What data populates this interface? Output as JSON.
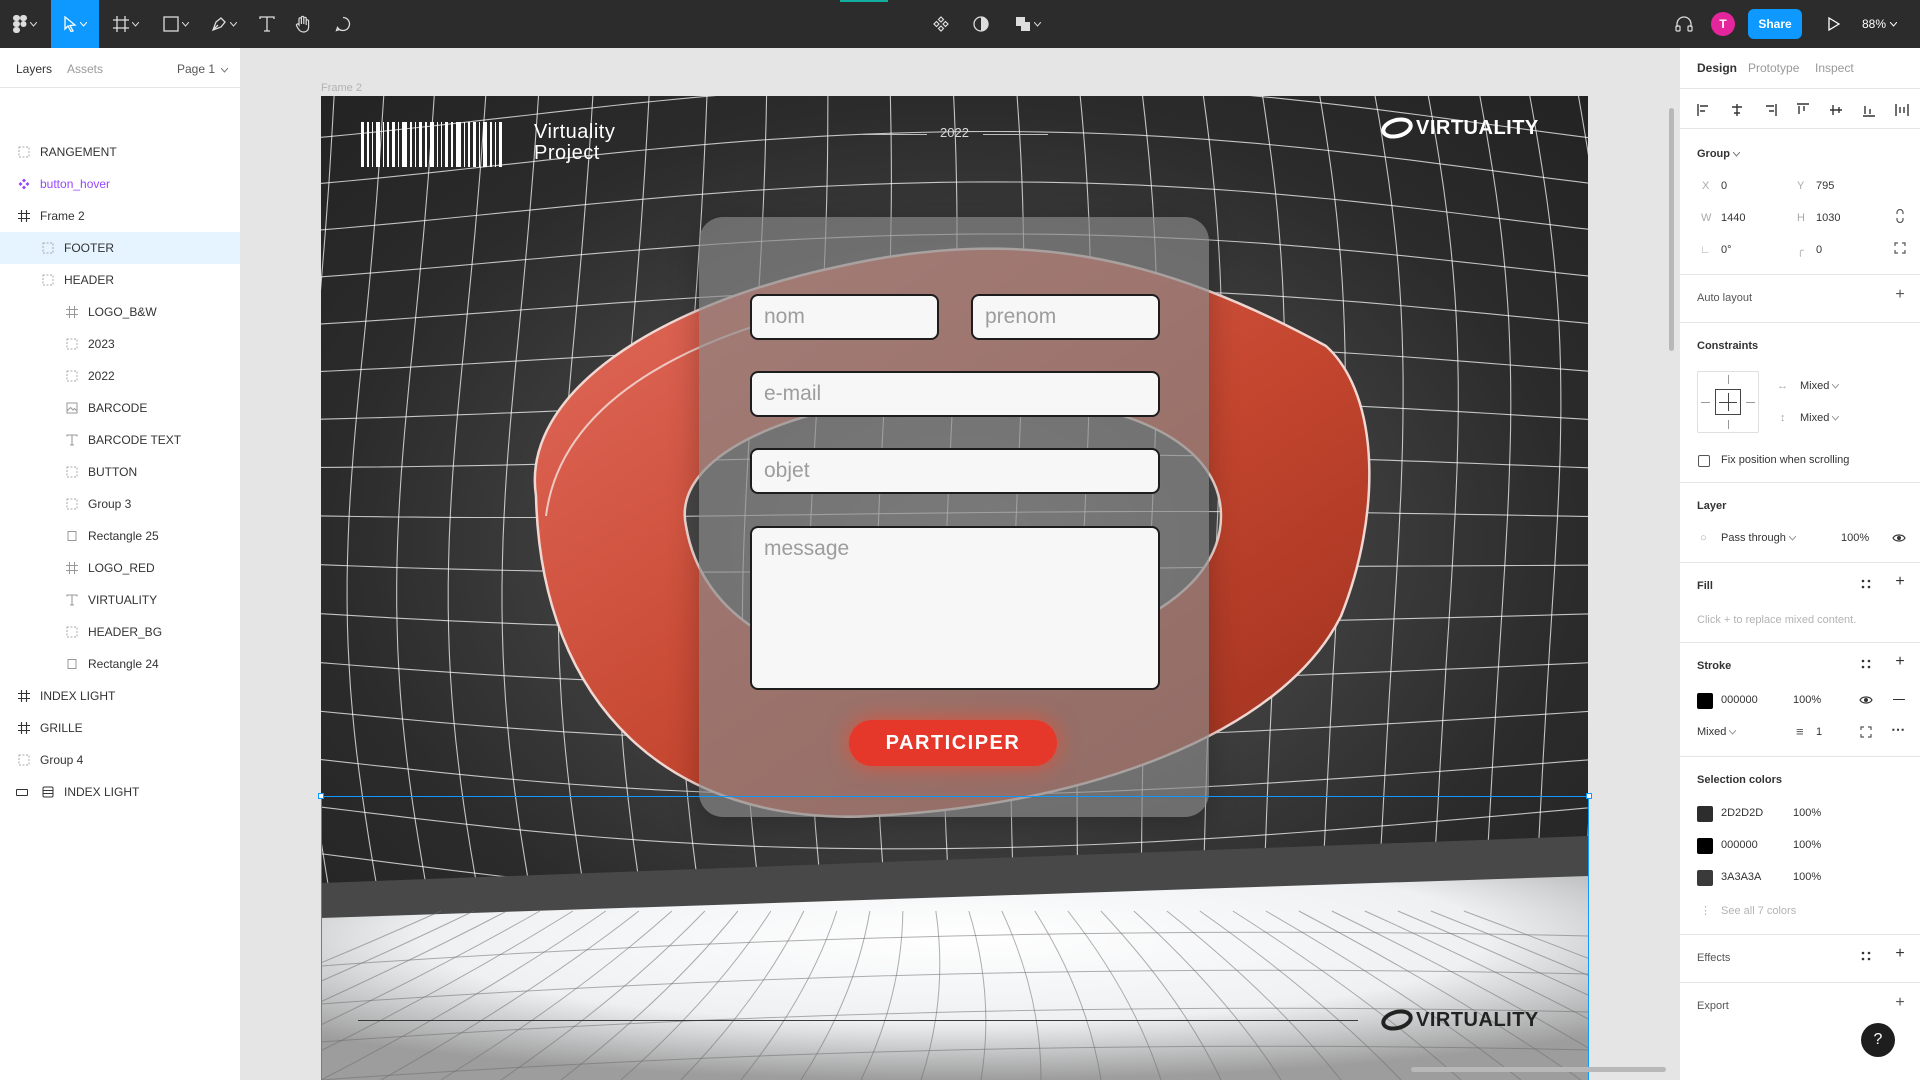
{
  "toolbar": {
    "zoom": "88%",
    "share_label": "Share",
    "avatar_initial": "T",
    "tools": [
      "main-menu-icon",
      "move-tool-icon",
      "frame-tool-icon",
      "rectangle-tool-icon",
      "pen-tool-icon",
      "text-tool-icon",
      "hand-tool-icon",
      "comment-tool-icon"
    ]
  },
  "left": {
    "tabs": [
      "Layers",
      "Assets"
    ],
    "page": "Page 1",
    "layers": [
      {
        "label": "RANGEMENT",
        "icon": "group-icon",
        "depth": 0
      },
      {
        "label": "button_hover",
        "icon": "component-icon",
        "depth": 0
      },
      {
        "label": "Frame 2",
        "icon": "frame-icon",
        "depth": 0
      },
      {
        "label": "FOOTER",
        "icon": "group-icon",
        "depth": 1,
        "selected": true
      },
      {
        "label": "HEADER",
        "icon": "group-icon",
        "depth": 1
      },
      {
        "label": "LOGO_B&W",
        "icon": "frame-icon",
        "depth": 2
      },
      {
        "label": "2023",
        "icon": "group-icon",
        "depth": 2
      },
      {
        "label": "2022",
        "icon": "group-icon",
        "depth": 2
      },
      {
        "label": "BARCODE",
        "icon": "image-icon",
        "depth": 2
      },
      {
        "label": "BARCODE TEXT",
        "icon": "text-icon",
        "depth": 2
      },
      {
        "label": "BUTTON",
        "icon": "group-icon",
        "depth": 2
      },
      {
        "label": "Group 3",
        "icon": "group-icon",
        "depth": 2
      },
      {
        "label": "Rectangle 25",
        "icon": "rectangle-icon",
        "depth": 2
      },
      {
        "label": "LOGO_RED",
        "icon": "frame-icon",
        "depth": 2
      },
      {
        "label": "VIRTUALITY",
        "icon": "text-icon",
        "depth": 2
      },
      {
        "label": "HEADER_BG",
        "icon": "group-icon",
        "depth": 2
      },
      {
        "label": "Rectangle 24",
        "icon": "rectangle-icon",
        "depth": 2
      },
      {
        "label": "INDEX LIGHT",
        "icon": "frame-icon",
        "depth": 0
      },
      {
        "label": "GRILLE",
        "icon": "frame-icon",
        "depth": 0
      },
      {
        "label": "Group 4",
        "icon": "group-icon",
        "depth": 0
      },
      {
        "label": "INDEX LIGHT",
        "icon": "section-icon",
        "depth": 0
      }
    ]
  },
  "canvas": {
    "frame_label": "Frame 2",
    "brand_line1": "Virtuality",
    "brand_line2": "Project",
    "year": "2022",
    "logo_text": "VIRTUALITY",
    "form": {
      "nom": "nom",
      "prenom": "prenom",
      "email": "e-mail",
      "objet": "objet",
      "message": "message",
      "cta": "PARTICIPER"
    },
    "colors": {
      "accent": "#e6382a",
      "dark_bg": "#2d2d2d",
      "selection": "#0d99ff"
    }
  },
  "right": {
    "tabs": [
      "Design",
      "Prototype",
      "Inspect"
    ],
    "group_label": "Group",
    "x_label": "X",
    "x": "0",
    "y_label": "Y",
    "y": "795",
    "w_label": "W",
    "w": "1440",
    "h_label": "H",
    "h": "1030",
    "rotation": "0°",
    "radius": "0",
    "auto_layout": "Auto layout",
    "constraints": "Constraints",
    "constraint_h": "Mixed",
    "constraint_v": "Mixed",
    "fix_position": "Fix position when scrolling",
    "layer": "Layer",
    "blend": "Pass through",
    "opacity": "100%",
    "fill": "Fill",
    "fill_hint": "Click + to replace mixed content.",
    "stroke": "Stroke",
    "stroke_color": "000000",
    "stroke_opacity": "100%",
    "stroke_align": "Mixed",
    "stroke_weight": "1",
    "selection_colors": "Selection colors",
    "colors": [
      {
        "hex": "2D2D2D",
        "opacity": "100%"
      },
      {
        "hex": "000000",
        "opacity": "100%"
      },
      {
        "hex": "3A3A3A",
        "opacity": "100%"
      }
    ],
    "see_all": "See all 7 colors",
    "effects": "Effects",
    "export": "Export"
  }
}
